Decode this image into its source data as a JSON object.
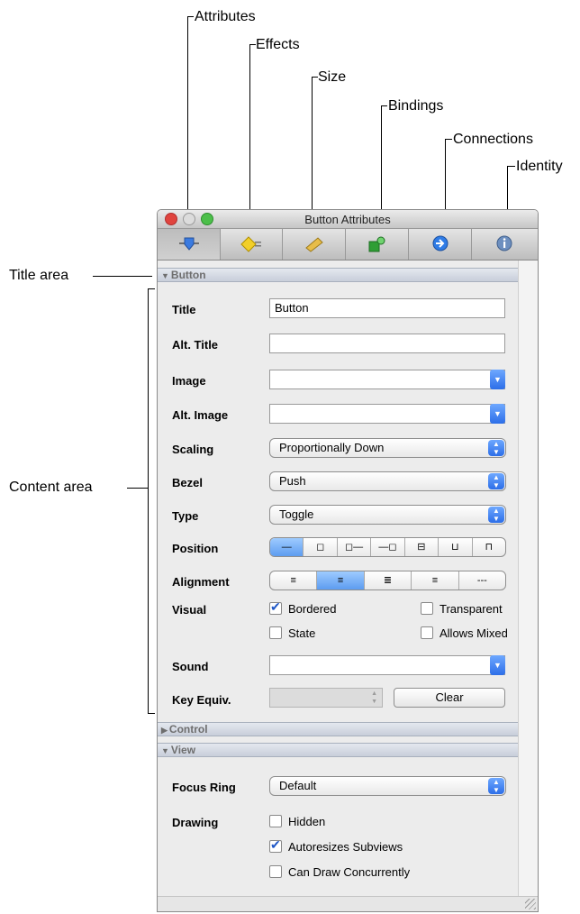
{
  "callouts": {
    "attributes": "Attributes",
    "effects": "Effects",
    "size": "Size",
    "bindings": "Bindings",
    "connections": "Connections",
    "identity": "Identity",
    "title_area": "Title area",
    "content_area": "Content area"
  },
  "window": {
    "title": "Button Attributes",
    "traffic_colors": {
      "close": "#e0443e",
      "minimize": "#d0d0d0",
      "zoom": "#4cbf4a"
    }
  },
  "toolbar": {
    "tabs": [
      {
        "icon": "slider-icon",
        "selected": true
      },
      {
        "icon": "diamond-effects-icon",
        "selected": false
      },
      {
        "icon": "ruler-icon",
        "selected": false
      },
      {
        "icon": "bindings-icon",
        "selected": false
      },
      {
        "icon": "connections-arrow-icon",
        "selected": false
      },
      {
        "icon": "info-icon",
        "selected": false
      }
    ]
  },
  "sections": {
    "button": "Button",
    "control": "Control",
    "view": "View"
  },
  "button": {
    "title_label": "Title",
    "title_value": "Button",
    "alt_title_label": "Alt. Title",
    "alt_title_value": "",
    "image_label": "Image",
    "image_value": "",
    "alt_image_label": "Alt. Image",
    "alt_image_value": "",
    "scaling_label": "Scaling",
    "scaling_value": "Proportionally Down",
    "bezel_label": "Bezel",
    "bezel_value": "Push",
    "type_label": "Type",
    "type_value": "Toggle",
    "position_label": "Position",
    "position_options": [
      "—",
      "◻",
      "◻—",
      "—◻",
      "⊟",
      "⊔",
      "⊓"
    ],
    "position_selected": 0,
    "alignment_label": "Alignment",
    "alignment_options": [
      "≡",
      "≡",
      "≣",
      "≡",
      "---"
    ],
    "alignment_selected": 1,
    "visual_label": "Visual",
    "bordered": "Bordered",
    "transparent": "Transparent",
    "state": "State",
    "allows_mixed": "Allows Mixed",
    "sound_label": "Sound",
    "sound_value": "",
    "key_equiv_label": "Key Equiv.",
    "clear_label": "Clear"
  },
  "view": {
    "focus_ring_label": "Focus Ring",
    "focus_ring_value": "Default",
    "drawing_label": "Drawing",
    "hidden": "Hidden",
    "autoresizes": "Autoresizes Subviews",
    "can_draw": "Can Draw Concurrently"
  }
}
